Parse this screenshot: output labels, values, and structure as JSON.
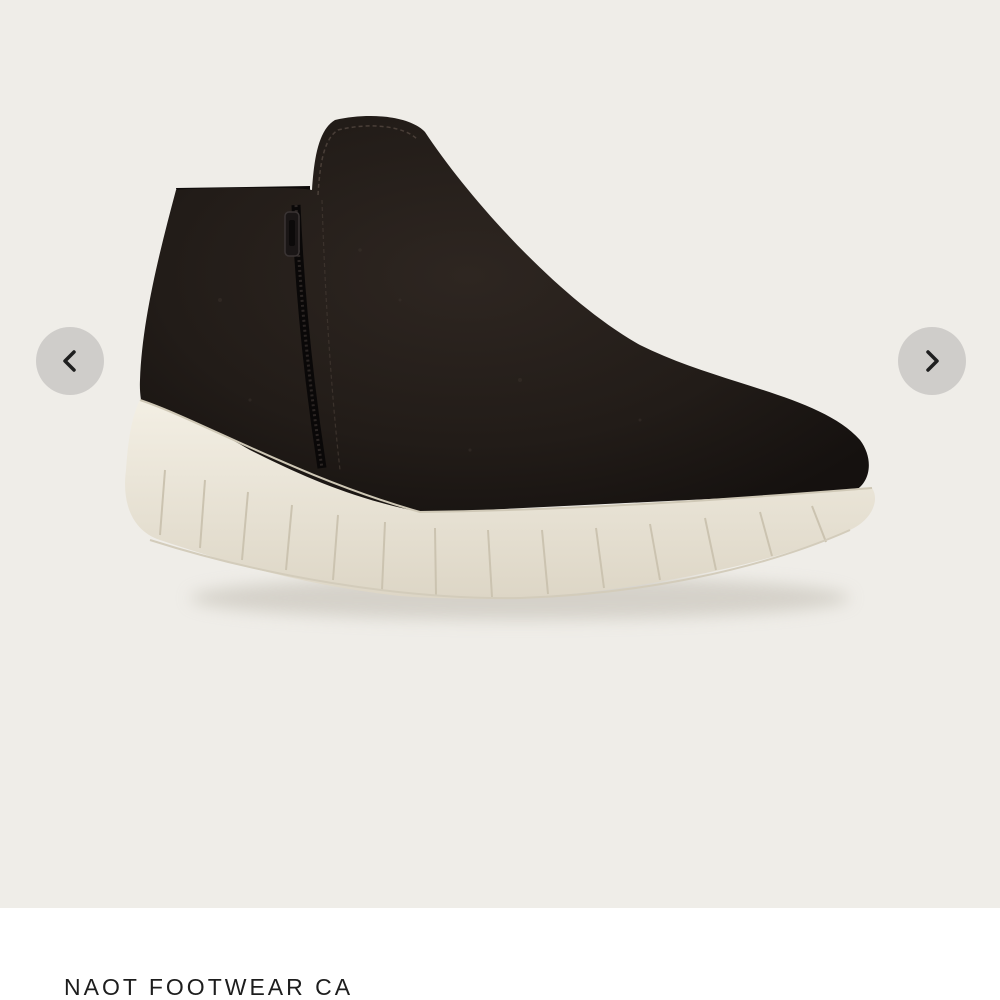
{
  "gallery": {
    "background_color": "#efede8",
    "image_alt": "Black suede ankle boot with side zipper and cream sole",
    "prev_icon": "chevron-left-icon",
    "next_icon": "chevron-right-icon",
    "arrow_bg_color": "#cfcdca",
    "arrow_icon_color": "#1f1f1f"
  },
  "product": {
    "brand": "NAOT FOOTWEAR CA"
  }
}
